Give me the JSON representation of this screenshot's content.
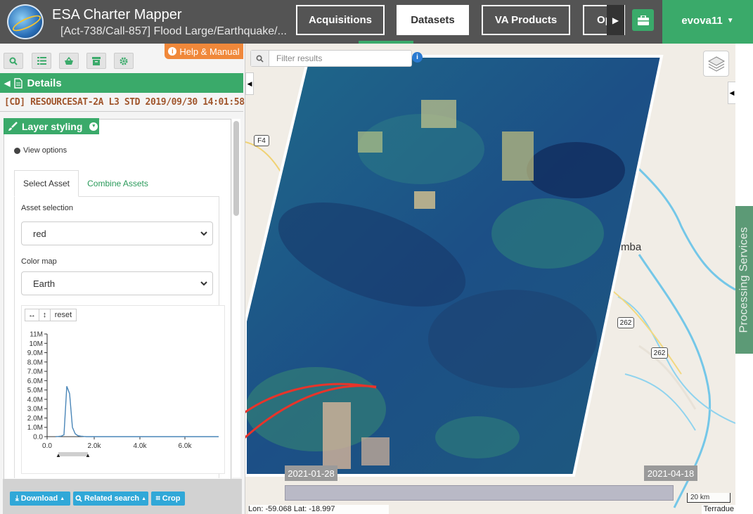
{
  "header": {
    "app_title": "ESA Charter Mapper",
    "subtitle": "[Act-738/Call-857] Flood Large/Earthquake/...",
    "nav": [
      "Acquisitions",
      "Datasets",
      "VA Products",
      "Open"
    ],
    "active_nav": "Datasets",
    "user": "evova11"
  },
  "left_panel": {
    "help_label": "Help & Manual",
    "details_label": "Details",
    "product_title": "[CD] RESOURCESAT-2A L3 STD 2019/09/30 14:01:58",
    "layer_styling_label": "Layer styling",
    "view_options_label": "View options",
    "tabs": [
      "Select Asset",
      "Combine Assets"
    ],
    "asset_selection_label": "Asset selection",
    "asset_selection_value": "red",
    "color_map_label": "Color map",
    "color_map_value": "Earth",
    "histogram": {
      "reset_label": "reset",
      "y_ticks": [
        "11M",
        "10M",
        "9.0M",
        "8.0M",
        "7.0M",
        "6.0M",
        "5.0M",
        "4.0M",
        "3.0M",
        "2.0M",
        "1.0M",
        "0.0"
      ],
      "x_ticks": [
        "0.0",
        "2.0k",
        "4.0k",
        "6.0k"
      ],
      "curve_y": [
        0,
        0.02,
        0.05,
        0.2,
        5.4,
        4.6,
        1.0,
        0.3,
        0.1,
        0.05,
        0.02,
        0,
        0,
        0,
        0,
        0,
        0,
        0
      ]
    },
    "buttons": {
      "download": "Download",
      "related_search": "Related search",
      "crop": "Crop"
    }
  },
  "map": {
    "search_placeholder": "Filter results",
    "town_label": "mba",
    "road_labels": [
      "F4",
      "262",
      "262"
    ],
    "time_start": "2021-01-28",
    "time_end": "2021-04-18",
    "scale_label": "20 km",
    "coords": "Lon: -59.068 Lat: -18.997",
    "attribution": "Terradue",
    "processing_services_label": "Processing Services"
  },
  "colors": {
    "header_bg": "#545454",
    "accent_green": "#3aaa6a",
    "help_orange": "#f0883a",
    "button_blue": "#30a8d8",
    "title_brown": "#a0552c",
    "arrow_red": "#e8342a"
  }
}
